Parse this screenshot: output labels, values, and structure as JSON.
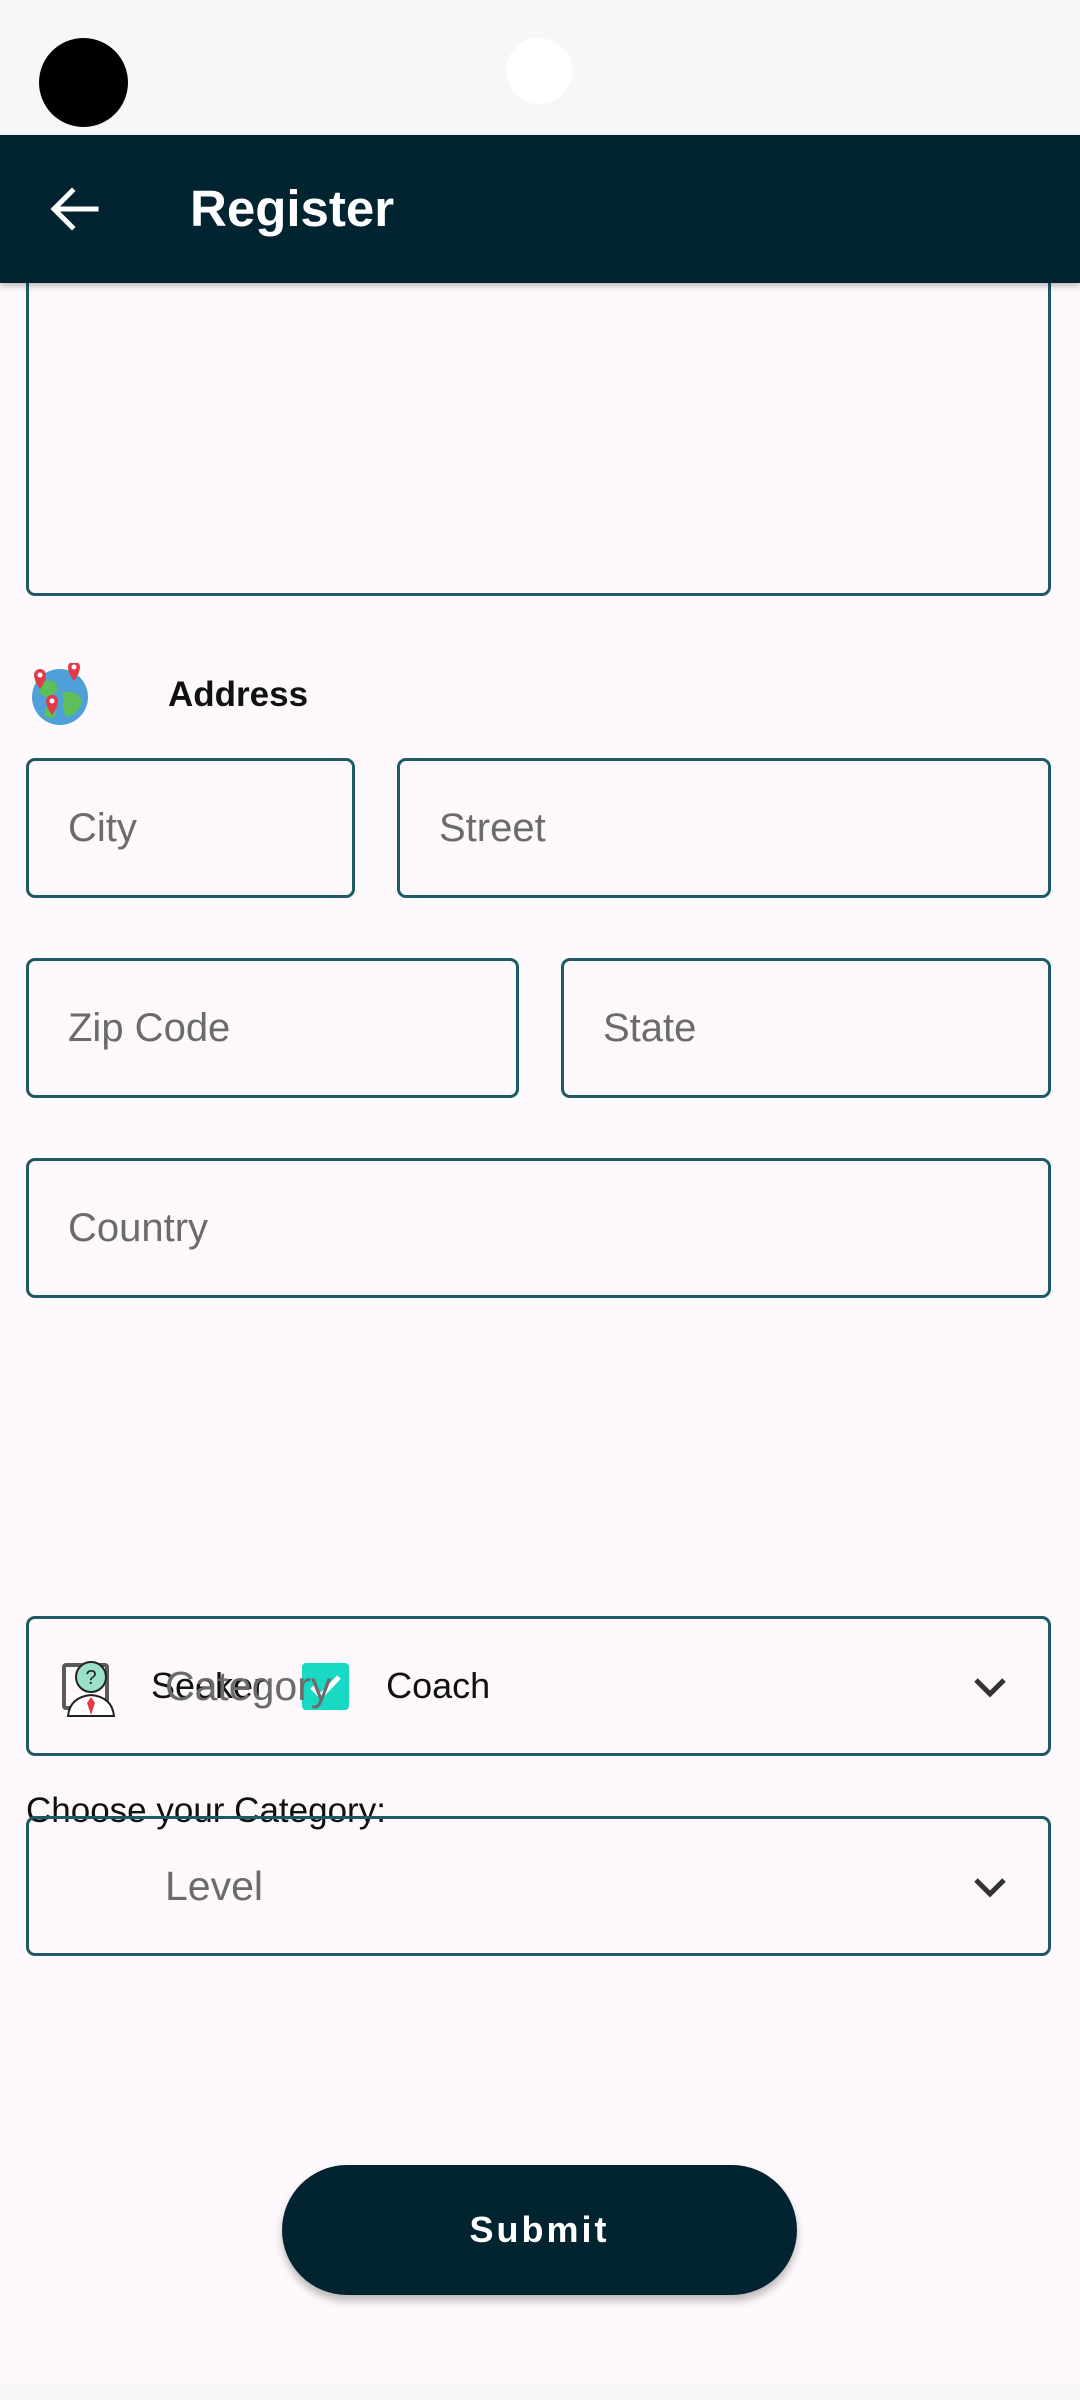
{
  "app_bar": {
    "title": "Register"
  },
  "address": {
    "label": "Address",
    "city_placeholder": "City",
    "street_placeholder": "Street",
    "zip_placeholder": "Zip Code",
    "state_placeholder": "State",
    "country_placeholder": "Country"
  },
  "roles": [
    {
      "label": "Seeker",
      "checked": false
    },
    {
      "label": "Coach",
      "checked": true
    }
  ],
  "category_section": {
    "prompt": "Choose your Category:",
    "category_placeholder": "Category",
    "level_placeholder": "Level"
  },
  "submit": {
    "label": "Submit"
  },
  "colors": {
    "app_bar": "#022330",
    "field_border": "#1e5a63",
    "checkbox_checked": "#19d8c4",
    "background": "#fdf8fb"
  },
  "icons": {
    "back": "arrow-left-icon",
    "address": "globe-map-pins-icon",
    "category": "person-question-icon",
    "dropdown": "chevron-down-icon"
  }
}
